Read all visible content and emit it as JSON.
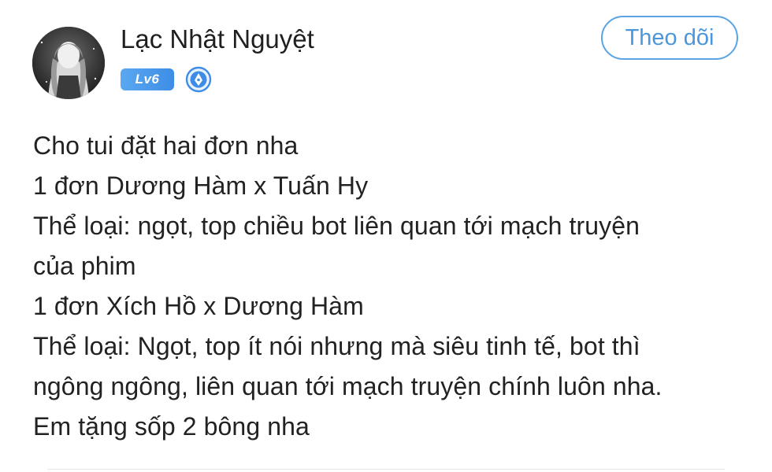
{
  "author": {
    "name": "Lạc Nhật Nguyệt",
    "level": "Lv6",
    "avatar_icon": "avatar-portrait-icon",
    "verified_icon": "verified-pen-icon"
  },
  "follow_button": {
    "label": "Theo dõi"
  },
  "post": {
    "lines": [
      "Cho tui đặt hai đơn nha",
      "1 đơn Dương Hàm x Tuấn Hy",
      "Thể loại: ngọt, top chiều bot liên quan tới mạch truyện",
      "của phim",
      "1 đơn Xích Hồ x Dương Hàm",
      "Thể loại: Ngọt, top ít nói nhưng mà siêu tinh tế, bot thì",
      "ngông ngông, liên quan tới mạch truyện chính luôn nha.",
      "Em tặng sốp 2 bông nha"
    ]
  },
  "colors": {
    "accent": "#4a97dd",
    "level_badge": "#3d8de6",
    "text": "#222222"
  }
}
